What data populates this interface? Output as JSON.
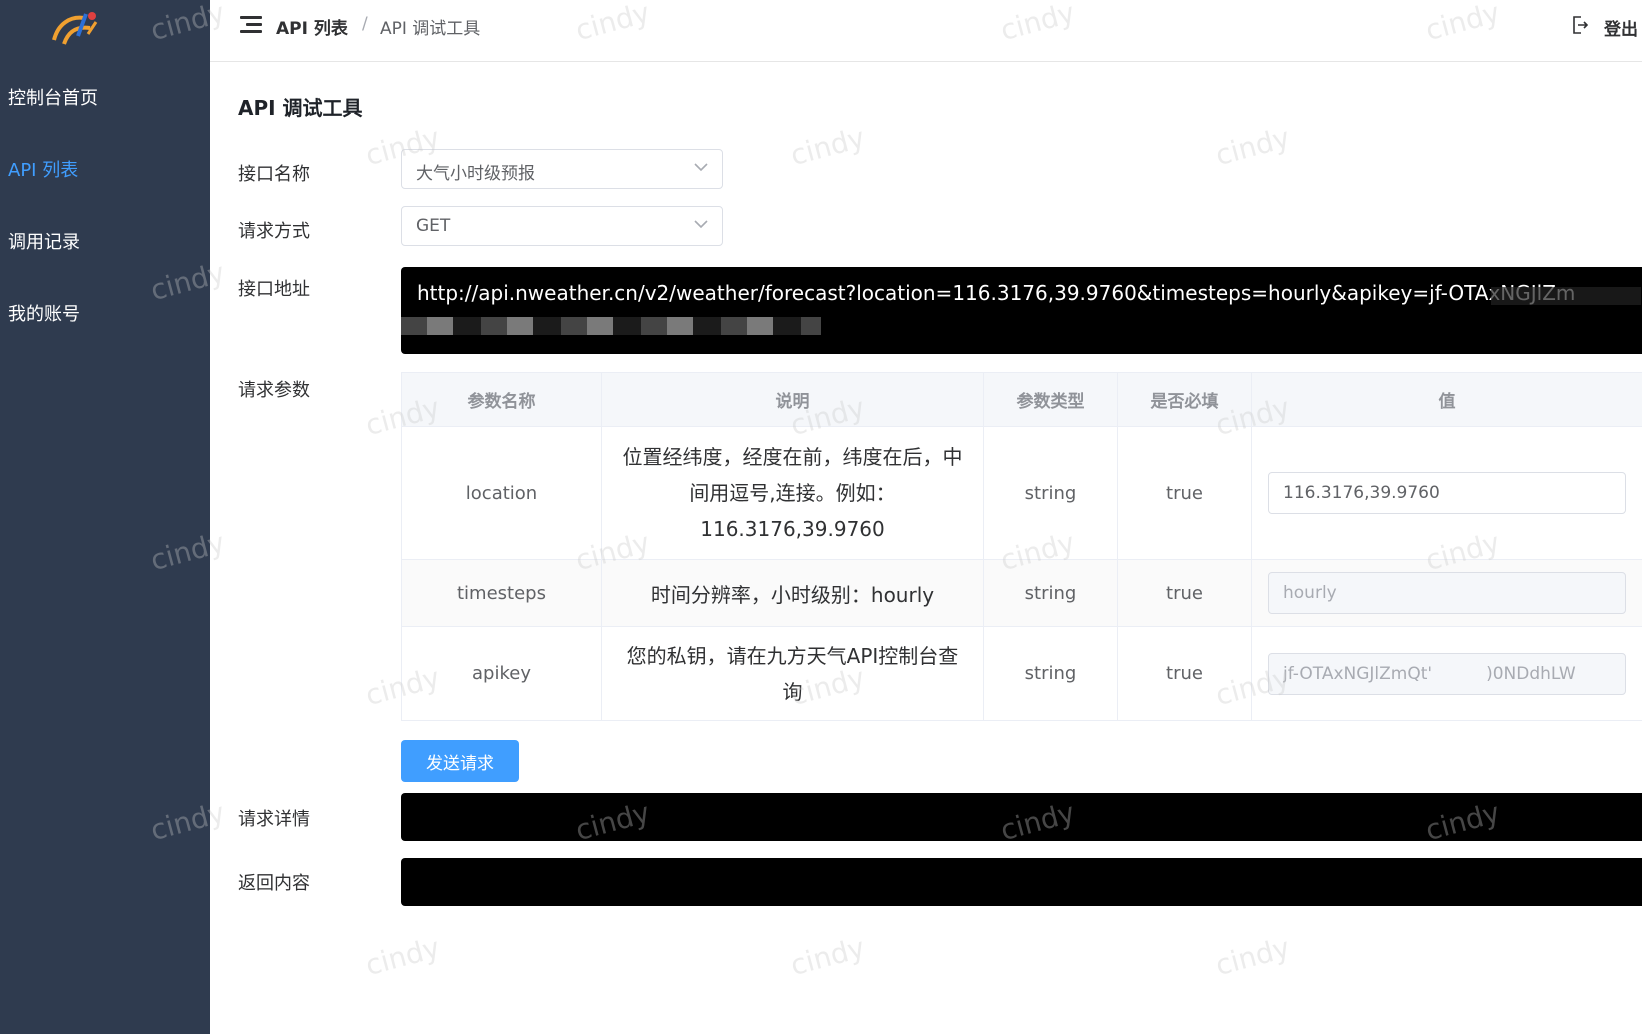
{
  "sidebar": {
    "items": [
      {
        "label": "控制台首页",
        "active": false
      },
      {
        "label": "API 列表",
        "active": true
      },
      {
        "label": "调用记录",
        "active": false
      },
      {
        "label": "我的账号",
        "active": false
      }
    ]
  },
  "header": {
    "breadcrumb": [
      "API 列表",
      "API 调试工具"
    ],
    "separator": "/",
    "logout_label": "登出"
  },
  "page": {
    "title": "API 调试工具"
  },
  "form": {
    "api_name_label": "接口名称",
    "api_name_value": "大气小时级预报",
    "method_label": "请求方式",
    "method_value": "GET",
    "url_label": "接口地址",
    "url_value": "http://api.nweather.cn/v2/weather/forecast?location=116.3176,39.9760&timesteps=hourly&apikey=jf-OTAxNGJlZm",
    "params_label": "请求参数",
    "details_label": "请求详情",
    "response_label": "返回内容"
  },
  "params_table": {
    "headers": [
      "参数名称",
      "说明",
      "参数类型",
      "是否必填",
      "值"
    ],
    "rows": [
      {
        "name": "location",
        "desc": "位置经纬度，经度在前，纬度在后，中间用逗号,连接。例如：116.3176,39.9760",
        "type": "string",
        "required": "true",
        "value": "116.3176,39.9760",
        "disabled": false
      },
      {
        "name": "timesteps",
        "desc": "时间分辨率，小时级别：hourly",
        "type": "string",
        "required": "true",
        "value": "hourly",
        "disabled": true
      },
      {
        "name": "apikey",
        "desc": "您的私钥，请在九方天气API控制台查询",
        "type": "string",
        "required": "true",
        "value": "jf-OTAxNGJlZmQt'          )0NDdhLW",
        "disabled": true
      }
    ]
  },
  "actions": {
    "send_label": "发送请求"
  },
  "watermark": "cindy",
  "colors": {
    "sidebar_bg": "#2f3b4f",
    "accent": "#409eff",
    "code_bg": "#000000"
  }
}
